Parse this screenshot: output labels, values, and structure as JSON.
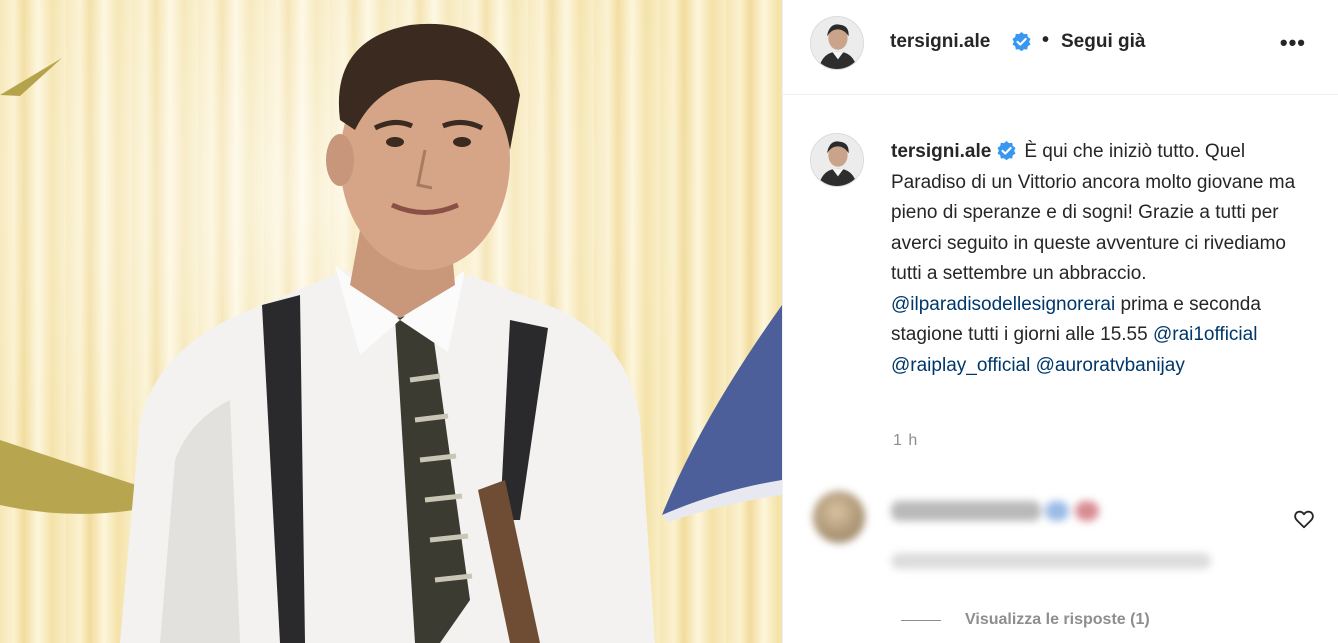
{
  "post": {
    "username": "tersigni.ale",
    "separator": "•",
    "follow_status": "Segui già",
    "more_icon": "more-horizontal-icon"
  },
  "caption": {
    "username": "tersigni.ale",
    "text": "È qui che iniziò tutto. Quel Paradiso di un Vittorio ancora molto giovane ma pieno di speranze e di sogni! Grazie a tutti per averci seguito in queste avventure ci rivediamo tutti a settembre un abbraccio. ",
    "mention1": "@ilparadisodellesignorerai",
    "text2": " prima e seconda stagione tutti i giorni alle 15.55 ",
    "mention2": "@rai1official",
    "space": " ",
    "mention3": "@raiplay_official",
    "mention4": "@auroratvbanijay"
  },
  "time": "1 h",
  "comment": {
    "view_replies": "Visualizza le risposte (1)"
  },
  "colors": {
    "link": "#00376b",
    "verified": "#3897f0",
    "muted": "#8e8e8e"
  }
}
